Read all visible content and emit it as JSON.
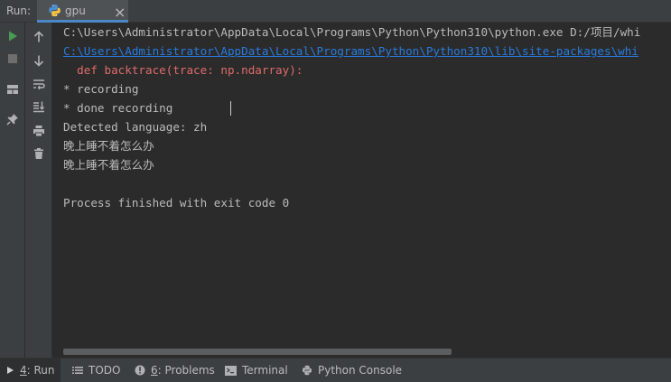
{
  "run_panel": {
    "label": "Run:",
    "tab_title": "gpu",
    "tab_close": "×"
  },
  "left_toolbar": {
    "icons": [
      "run-icon",
      "stop-icon",
      "layout-icon",
      "pin-icon"
    ]
  },
  "second_toolbar": {
    "icons": [
      "arrow-up-icon",
      "arrow-down-icon",
      "soft-wrap-icon",
      "scroll-to-end-icon",
      "print-icon",
      "trash-icon"
    ]
  },
  "console": {
    "lines": [
      "C:\\Users\\Administrator\\AppData\\Local\\Programs\\Python\\Python310\\python.exe D:/项目/whi",
      "C:\\Users\\Administrator\\AppData\\Local\\Programs\\Python\\Python310\\lib\\site-packages\\whi",
      "  def backtrace(trace: np.ndarray):",
      "* recording",
      "* done recording",
      "Detected language: zh",
      "晚上睡不着怎么办",
      "晚上睡不着怎么办",
      "",
      "Process finished with exit code 0"
    ]
  },
  "bottom_bar": {
    "run": {
      "mnemonic": "4",
      "label": ": Run"
    },
    "todo": {
      "label": "TODO"
    },
    "problems": {
      "mnemonic": "6",
      "label": ": Problems"
    },
    "terminal": {
      "label": "Terminal"
    },
    "python_console": {
      "label": "Python Console"
    }
  },
  "colors": {
    "background": "#2b2b2b",
    "panel": "#3c3f41",
    "link": "#287bde",
    "warning": "#e06b6b",
    "run_green": "#499c54"
  }
}
